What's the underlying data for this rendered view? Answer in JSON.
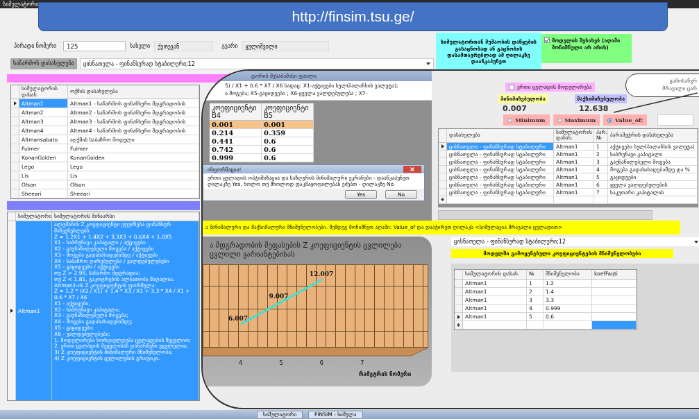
{
  "window": {
    "title": "სიმულატორი"
  },
  "banner": {
    "url": "http://finsim.tsu.ge/"
  },
  "person": {
    "id_label": "პირადი ნომერი",
    "id_value": "125",
    "name_label": "სახელი",
    "name_value": "ქეთევან",
    "surname_label": "გვარი",
    "surname_value": "ყულიშვილი"
  },
  "company": {
    "label": "საწარმოს დასახელება",
    "value": "ცისნათელა - ფინანსურად სტაბილური;12"
  },
  "start_button": "სიმულატორთან მუშაობის დაწყების გასაცნობად ან გაცნობის დასამთავრებლად ამ ღილაკზე დააწკაპუნეთ",
  "model_info": {
    "label": "მოდელის შესახებ (აღამი მონიშნული არ არის)",
    "checked": true
  },
  "simulators_table": {
    "columns": [
      "სიმულატორის დასახ.",
      "ოქმის დასახელება"
    ],
    "rows": [
      {
        "cells": [
          "Altman1",
          "Altman1 - საწარმოს ფინანსური მდგრადობის"
        ],
        "selected": true
      },
      {
        "cells": [
          "Altman2",
          "Altman2 - საწარმოს ფინანსური მდგრადობის"
        ],
        "selected": false
      },
      {
        "cells": [
          "Altman3",
          "Altman3 - საწარმოს ფინანსური მდგრადობის"
        ],
        "selected": false
      },
      {
        "cells": [
          "Altman4",
          "Altman4 - საწარმოს ფინანსური მდგრადობის"
        ],
        "selected": false
      },
      {
        "cells": [
          "Altmansabato",
          "აღქმის საბაზრო მოდელი"
        ],
        "selected": false
      },
      {
        "cells": [
          "Fulmer",
          "Fulmer"
        ],
        "selected": false
      },
      {
        "cells": [
          "KonanGolden",
          "KonanGolden"
        ],
        "selected": false
      },
      {
        "cells": [
          "Lego",
          "Lego"
        ],
        "selected": false
      },
      {
        "cells": [
          "Lis",
          "Lis"
        ],
        "selected": false
      },
      {
        "cells": [
          "Olson",
          "Olson"
        ],
        "selected": false
      },
      {
        "cells": [
          "Sheeari",
          "Sheeari"
        ],
        "selected": false
      }
    ]
  },
  "contents_table": {
    "columns": [
      "სიმულატორი",
      "სიმულატორის შინაარსი"
    ],
    "rows": [
      {
        "name": "Altman1",
        "selected": true,
        "lines": [
          "ალტმანის Z კოეფიციენტი ეფუძნება ფინანსურ მაჩვენებლებს.",
          "Z = 1.2X1 + 1.4X2 + 3.3X3 + 0.6X4 + 1.0X5",
          "X1 - საბრუნავი კაპიტალი / აქტივები",
          "X2 - გაუნაწილებელი მოგება / აქტივები",
          "X3 - მოგება გადასახადებამდე / აქტივები",
          "X4 - საბაზრო ღირებულება / ვალდებულებები",
          "X5 - გაყიდვები / აქტივები",
          "თუ Z > 2.99, საწარმო მდგრადია;",
          "თუ Z < 1.81, გაკოტრების ალბათობა მაღალია.",
          "Altman1-ის Z კოეფიციენტის ფორმულა:",
          "Z = 1.2 * (X2 / X1) + 1.4 * X3 / X1 + 3.3 * X4 / X1 + 0.6 * X7 / X6",
          "X1 - აქტივები;",
          "X2 - საბრუნავი კაპიტალი;",
          "X3 - გაუნაწილებელი მოგება;",
          "X4 - მოგება გადასახადებამდე;",
          "X5 - გაყიდვები;",
          "X6 - ვალდებულებები;",
          "1. მოდელირება ხორციელდება ცვლადების შეცვლით;",
          "2. ერთი ცვლადის შეცვლისას დანარჩენი უცვლელია;",
          "3) Z კოეფიციენტის მინიმალური მნიშვნელობა;",
          "4) Z კოეფიციენტის ცვლილების გრაფიკი."
        ]
      }
    ]
  },
  "zoom": {
    "header": "ტორის შესაბამისი ფაილი",
    "formula_lines": [
      "5) / X1 + 0.6 * X7 / X6 სადაც: X1-აქტივები სულ(ბალანსის ვალუტა);",
      "ი მოგება; X5-გაყიდვები ; X6-ყველა ვალდებულება ; X7-"
    ],
    "b_table": {
      "columns": [
        "კოეფიციენტი B4",
        "კოეფიციენტი B5"
      ],
      "rows": [
        {
          "cells": [
            "0.001",
            "0.001"
          ],
          "selected": true
        },
        {
          "cells": [
            "0.214",
            "0.359"
          ],
          "selected": false
        },
        {
          "cells": [
            "0.441",
            "0.6"
          ],
          "selected": false
        },
        {
          "cells": [
            "0.742",
            "0.6"
          ],
          "selected": false
        },
        {
          "cells": [
            "0.999",
            "0.6"
          ],
          "selected": false
        }
      ]
    },
    "dialog": {
      "title": "ინფორმაცია!",
      "lines": [
        "ერთი ცვლადის ოპტიმიზაცია და საზღვრის მინიმალური ეკრანები - დააწკაპუნეთ",
        "ღილაკზე Yes, ხოლო თუ მხოლოდ დაკმაყოფილებას ეძებთ - ღილაკზე No"
      ],
      "buttons": [
        "Yes",
        "No"
      ]
    },
    "single_variable": {
      "label": "ერთი ცვლადის მოდელირება",
      "checked": false
    },
    "min": {
      "label": "მინიმიზებულობა",
      "value": "0.007"
    },
    "max": {
      "label": "მაქსიმიზებულობა",
      "value": "12.638"
    },
    "modes": [
      {
        "label": "Minimum",
        "selected": false
      },
      {
        "label": "Maximum",
        "selected": false
      },
      {
        "label": "Value_of:",
        "selected": true
      }
    ],
    "params_table": {
      "columns": [
        "დასახელება",
        "სიმულატორის დასახ.",
        "პარ. №",
        "პარამეტრის დასახელება"
      ],
      "rows": [
        {
          "cells": [
            "ცისნათელა - ფინანსურად სტაბილური",
            "Altman1",
            "1",
            "აქტივები სულ(ბალანსის ვალუტა)"
          ],
          "selected": true
        },
        {
          "cells": [
            "ცისნათელა - ფინანსურად სტაბილური",
            "Altman1",
            "2",
            "საბრუნავი კაპიტალი"
          ],
          "selected": false
        },
        {
          "cells": [
            "ცისნათელა - ფინანსურად სტაბილური",
            "Altman1",
            "3",
            "გაუნაწილებელი მოგება"
          ],
          "selected": false
        },
        {
          "cells": [
            "ცისნათელა - ფინანსურად სტაბილური",
            "Altman1",
            "4",
            "მოგება გადასახადებამდე და %"
          ],
          "selected": false
        },
        {
          "cells": [
            "ცისნათელა - ფინანსურად სტაბილური",
            "Altman1",
            "5",
            "გაყიდვები"
          ],
          "selected": false
        },
        {
          "cells": [
            "ცისნათელა - ფინანსურად სტაბილური",
            "Altman1",
            "6",
            "ყველა ვალდებულების"
          ],
          "selected": false
        },
        {
          "cells": [
            "ცისნათელა - ფინანსურად სტაბილური",
            "Altman1",
            "7",
            "საკუთარი კაპიტალის"
          ],
          "selected": false
        }
      ]
    },
    "instruction": "ა მინიმალური და მაქსიმალური მნიშვნელობები. შემდეგ მონიშნეთ აღამი: Value_of და დააჭირეთ ღილაკს <სიმულაცია მრავალი ცვლადით>",
    "chart": {
      "chart_data": {
        "type": "line",
        "title": "ა მდგრადობის შეფასების  Z კოეფიციენტის ცვლილება ცვლილი ვარიანტებისას",
        "xlabel": "რამეტრის ნომერი",
        "x": [
          4,
          5,
          6
        ],
        "series": [
          {
            "color": "#40e0d0",
            "values": [
              6.007,
              9.007,
              12.007
            ]
          }
        ],
        "xlim": [
          3.06,
          8.62
        ],
        "xticks": [
          4,
          5,
          6,
          7
        ],
        "data_labels": true
      }
    },
    "company_select": "ცისნათელა - ფინანსურად სტაბილური;12",
    "coefficients_title": "მოდელში გამოყენებული კოეფიციენტების მნიშვნელობები",
    "coefficients_table": {
      "columns": [
        "სიმულატორის დასახ.",
        "№",
        "მნიშვნელობა",
        "koefFaqti"
      ],
      "rows": [
        {
          "cells": [
            "Altman1",
            "1",
            "1.2"
          ],
          "selected": false
        },
        {
          "cells": [
            "Altman1",
            "2",
            "1.4"
          ],
          "selected": false
        },
        {
          "cells": [
            "Altman1",
            "3",
            "3.3"
          ],
          "selected": false
        },
        {
          "cells": [
            "Altman1",
            "4",
            "0.999"
          ],
          "selected": false
        },
        {
          "cells": [
            "Altman1",
            "5",
            "0.6"
          ],
          "selected": true
        }
      ]
    }
  },
  "callout": {
    "lines": [
      "გამოსაწვრ",
      "მრავალი ცარ"
    ]
  },
  "taskbar": [
    {
      "label": "სიმულატორი"
    },
    {
      "label": "FINSIM - სიმულა"
    }
  ]
}
